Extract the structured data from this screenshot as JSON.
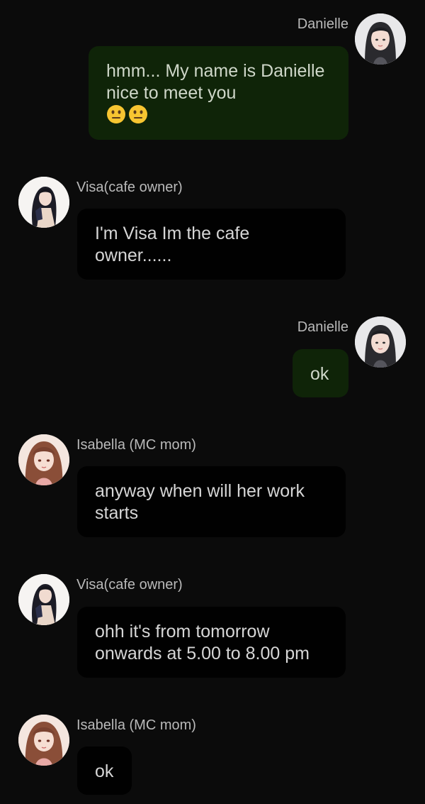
{
  "messages": [
    {
      "sender": "Danielle",
      "side": "right",
      "text": "hmm... My name is Danielle nice to meet you",
      "emojis": [
        "neutral-face",
        "neutral-face"
      ],
      "avatar": "danielle-avatar"
    },
    {
      "sender": "Visa(cafe owner)",
      "side": "left",
      "text": "I'm Visa Im the cafe owner......",
      "avatar": "visa-avatar"
    },
    {
      "sender": "Danielle",
      "side": "right",
      "text": "ok",
      "avatar": "danielle-avatar"
    },
    {
      "sender": "Isabella (MC mom)",
      "side": "left",
      "text": "anyway when will her work starts",
      "avatar": "isabella-avatar"
    },
    {
      "sender": "Visa(cafe owner)",
      "side": "left",
      "text": "ohh it's from tomorrow onwards at 5.00 to 8.00 pm",
      "avatar": "visa-avatar"
    },
    {
      "sender": "Isabella (MC mom)",
      "side": "left",
      "text": "ok",
      "avatar": "isabella-avatar"
    }
  ],
  "colors": {
    "background": "#0b0b0b",
    "outgoing_bubble": "#0f2408",
    "incoming_bubble": "#010101",
    "name_text": "#b9b9b9"
  }
}
